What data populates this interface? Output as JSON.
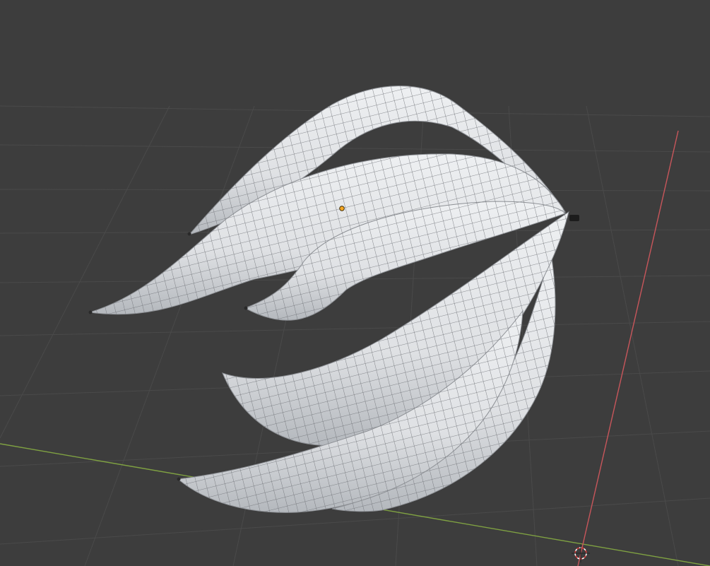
{
  "viewport": {
    "background": "#3d3d3d",
    "grid_color": "#4a4a4a",
    "x_axis_color": "#c8565b",
    "y_axis_color": "#7fa142"
  },
  "mesh": {
    "surface_color": "#e3e4e6",
    "shade_color": "#b9bcc0",
    "wire_color": "#6a6d72",
    "tip_color": "#2a2a2a",
    "origin_color": "#f5a623"
  },
  "icons": {
    "cursor": "3d-cursor-icon",
    "origin": "object-origin-icon"
  }
}
